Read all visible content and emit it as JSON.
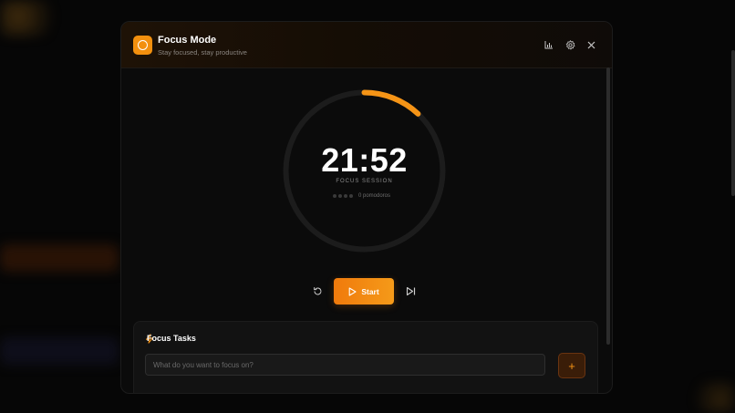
{
  "header": {
    "title": "Focus Mode",
    "subtitle": "Stay focused, stay productive",
    "icons": [
      "stats-icon",
      "settings-icon",
      "close-icon"
    ]
  },
  "timer": {
    "time": "21:52",
    "label": "FOCUS SESSION",
    "pomodoro_count_text": "0 pomodoros",
    "pomodoro_dots": 4,
    "progress_fraction": 0.12
  },
  "controls": {
    "start_label": "Start",
    "reset_icon": "reset-icon",
    "skip_icon": "skip-icon"
  },
  "tasks": {
    "title": "Focus Tasks",
    "input_placeholder": "What do you want to focus on?",
    "input_value": "",
    "add_label": "+"
  },
  "colors": {
    "accent": "#f59416",
    "accent_dark": "#f07a0c",
    "background": "#0b0b0b",
    "ring_track": "#1e1e1e"
  }
}
